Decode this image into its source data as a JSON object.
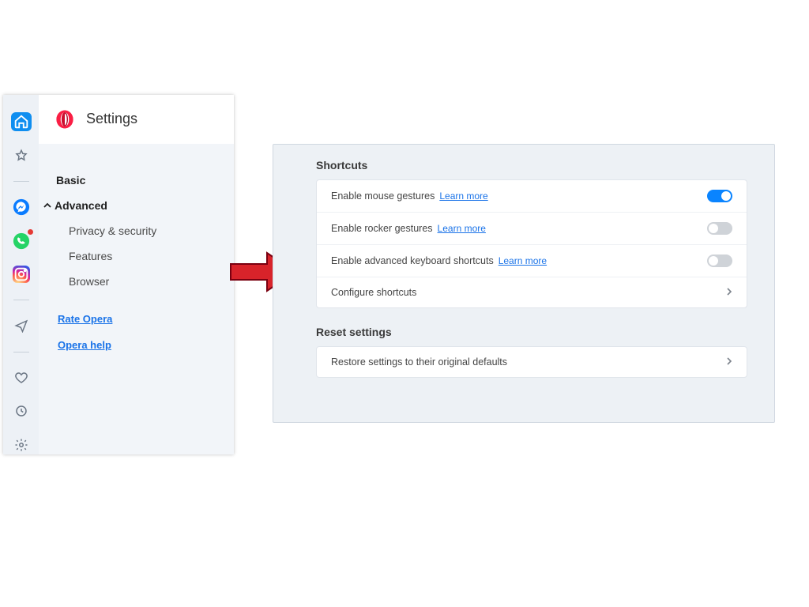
{
  "header": {
    "title": "Settings"
  },
  "nav": {
    "basic": "Basic",
    "advanced": "Advanced",
    "privacy": "Privacy & security",
    "features": "Features",
    "browser": "Browser",
    "rate": "Rate Opera",
    "help": "Opera help"
  },
  "rail_icons": {
    "home": "home-icon",
    "star": "star-icon",
    "messenger": "messenger-icon",
    "whatsapp": "whatsapp-icon",
    "instagram": "instagram-icon",
    "send": "send-icon",
    "heart": "heart-icon",
    "clock": "clock-icon",
    "gear": "gear-icon"
  },
  "sections": {
    "shortcuts": {
      "title": "Shortcuts",
      "mouse": {
        "label": "Enable mouse gestures",
        "learn": "Learn more",
        "on": true
      },
      "rocker": {
        "label": "Enable rocker gestures",
        "learn": "Learn more",
        "on": false
      },
      "keyboard": {
        "label": "Enable advanced keyboard shortcuts",
        "learn": "Learn more",
        "on": false
      },
      "configure": "Configure shortcuts"
    },
    "reset": {
      "title": "Reset settings",
      "restore": "Restore settings to their original defaults"
    }
  }
}
